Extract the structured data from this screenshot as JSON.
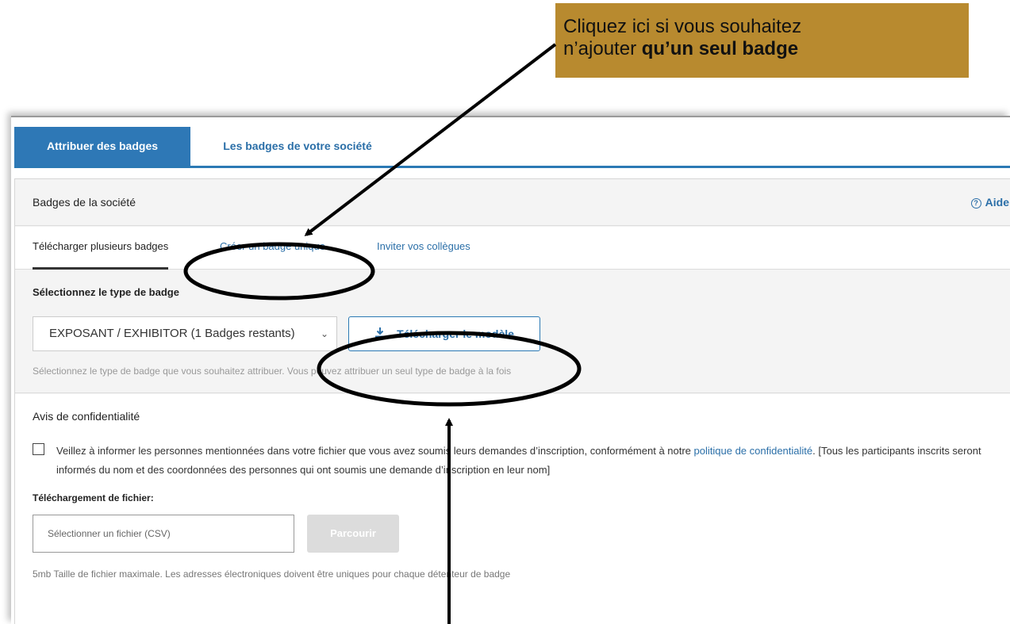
{
  "callout": {
    "line1": "Cliquez ici si vous souhaitez",
    "line2_prefix": "n’ajouter ",
    "line2_bold": "qu’un seul badge",
    "background": "#b88a2f"
  },
  "tabs": {
    "active": "Attribuer des badges",
    "inactive": "Les badges de votre société"
  },
  "card": {
    "title": "Badges de la société",
    "help": "Aide",
    "help_icon": "question-circle-icon"
  },
  "subtabs": {
    "upload_multiple": "Télécharger plusieurs badges",
    "create_single": "Créer un badge unique",
    "invite": "Inviter vos collègues"
  },
  "badge_type": {
    "label": "Sélectionnez le type de badge",
    "selected": "EXPOSANT / EXHIBITOR (1 Badges restants)",
    "download_button": "Télécharger le modèle",
    "download_icon": "download-icon",
    "hint": "Sélectionnez le type de badge que vous souhaitez attribuer. Vous pouvez attribuer un seul type de badge à la fois"
  },
  "privacy": {
    "title": "Avis de confidentialité",
    "text_before": "Veillez à informer les personnes mentionnées dans votre fichier que vous avez soumis leurs demandes d’inscription, conformément à notre ",
    "link": "politique de confidentialité",
    "text_after": ". [Tous les participants inscrits seront informés du nom et des coordonnées des personnes qui ont soumis une demande d’inscription en leur nom]"
  },
  "upload": {
    "label": "Téléchargement de fichier:",
    "placeholder": "Sélectionner un fichier (CSV)",
    "browse": "Parcourir",
    "footnote": "5mb Taille de fichier maximale. Les adresses électroniques doivent être uniques pour chaque détenteur de badge"
  },
  "colors": {
    "primary": "#2e78b6",
    "link": "#2b6fa8"
  }
}
